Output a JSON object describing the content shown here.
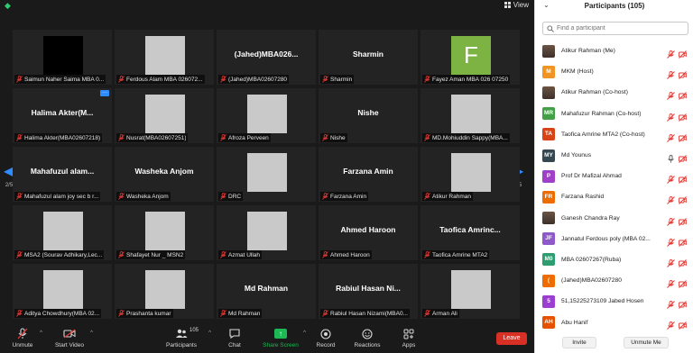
{
  "topbar": {
    "view_label": "View"
  },
  "tiles": [
    {
      "label": "Saimun Naher Saima MBA 0...",
      "display_name": "",
      "media": "black",
      "mic": "muted"
    },
    {
      "label": "Ferdous Alam MBA 026072...",
      "display_name": "",
      "media": "photo",
      "mic": "muted"
    },
    {
      "label": "(Jahed)MBA02607280",
      "display_name": "(Jahed)MBA026...",
      "media": "none",
      "mic": "muted"
    },
    {
      "label": "Sharmin",
      "display_name": "Sharmin",
      "media": "none",
      "mic": "muted"
    },
    {
      "label": "Fayez Aman  MBA 026 07250",
      "display_name": "",
      "media": "letter",
      "letter": "F",
      "mic": "muted"
    },
    {
      "label": "Halima Akter(MBA02607218)",
      "display_name": "Halima  Akter(M...",
      "media": "none",
      "mic": "muted",
      "more": true
    },
    {
      "label": "Nusrat(MBA02607251)",
      "display_name": "",
      "media": "photo",
      "mic": "muted"
    },
    {
      "label": "Afroza Perveen",
      "display_name": "",
      "media": "photo",
      "mic": "muted"
    },
    {
      "label": "Nishe",
      "display_name": "Nishe",
      "media": "none",
      "mic": "muted"
    },
    {
      "label": "MD.Mohiuddin Sappy(MBA...",
      "display_name": "",
      "media": "photo",
      "mic": "muted"
    },
    {
      "label": "Mahafuzul alam joy sec b r...",
      "display_name": "Mahafuzul  alam...",
      "media": "none",
      "mic": "muted"
    },
    {
      "label": "Washeka Anjom",
      "display_name": "Washeka Anjom",
      "media": "none",
      "mic": "muted"
    },
    {
      "label": "DRC",
      "display_name": "",
      "media": "photo",
      "mic": "muted"
    },
    {
      "label": "Farzana Amin",
      "display_name": "Farzana Amin",
      "media": "none",
      "mic": "muted"
    },
    {
      "label": "Atikur Rahman",
      "display_name": "",
      "media": "photo",
      "mic": "muted"
    },
    {
      "label": "MSA2 (Sourav Adhikary,Lec...",
      "display_name": "",
      "media": "photo",
      "mic": "muted"
    },
    {
      "label": "Shafayet Nur _ MSN2",
      "display_name": "",
      "media": "photo",
      "mic": "muted"
    },
    {
      "label": "Azmat Ullah",
      "display_name": "",
      "media": "photo",
      "mic": "muted"
    },
    {
      "label": "Ahmed Haroon",
      "display_name": "Ahmed Haroon",
      "media": "none",
      "mic": "muted"
    },
    {
      "label": "Taofica Amrine MTA2",
      "display_name": "Taofica  Amrinc...",
      "media": "none",
      "mic": "muted"
    },
    {
      "label": "Aditya Chowdhury(MBA 02...",
      "display_name": "",
      "media": "photo",
      "mic": "muted"
    },
    {
      "label": "Prashanta kumar",
      "display_name": "",
      "media": "photo",
      "mic": "muted"
    },
    {
      "label": "Md Rahman",
      "display_name": "Md Rahman",
      "media": "none",
      "mic": "muted"
    },
    {
      "label": "Rabiul Hasan Nizami(MBA0...",
      "display_name": "Rabiul  Hasan  Ni...",
      "media": "none",
      "mic": "muted"
    },
    {
      "label": "Arman Ali",
      "display_name": "",
      "media": "photo",
      "mic": "muted"
    }
  ],
  "pager": {
    "left_page": "2/5",
    "right_page": "2/5"
  },
  "toolbar": {
    "unmute": "Unmute",
    "start_video": "Start Video",
    "participants": "Participants",
    "participants_count": "105",
    "chat": "Chat",
    "share_screen": "Share Screen",
    "record": "Record",
    "reactions": "Reactions",
    "apps": "Apps",
    "leave": "Leave"
  },
  "panel": {
    "title": "Participants (105)",
    "search_placeholder": "Find a participant",
    "invite": "Invite",
    "unmute_me": "Unmute Me",
    "participants": [
      {
        "name": "Atikur Rahman (Me)",
        "initials": "",
        "color": "",
        "image": true,
        "mic": "muted",
        "video": "off"
      },
      {
        "name": "MKM (Host)",
        "initials": "M",
        "color": "#f29423",
        "image": false,
        "mic": "muted",
        "video": "off"
      },
      {
        "name": "Atikur Rahman (Co-host)",
        "initials": "",
        "color": "",
        "image": true,
        "mic": "muted",
        "video": "off"
      },
      {
        "name": "Mahafuzur Rahman (Co-host)",
        "initials": "MR",
        "color": "#43a047",
        "image": false,
        "mic": "muted",
        "video": "off"
      },
      {
        "name": "Taofica Amrine MTA2 (Co-host)",
        "initials": "TA",
        "color": "#d84315",
        "image": false,
        "mic": "muted",
        "video": "off"
      },
      {
        "name": "Md Younus",
        "initials": "MY",
        "color": "#37474f",
        "image": false,
        "mic": "on",
        "video": "off"
      },
      {
        "name": "Prof Dr Mafizal Ahmad",
        "initials": "P",
        "color": "#a040c8",
        "image": false,
        "mic": "muted",
        "video": "off"
      },
      {
        "name": "Farzana Rashid",
        "initials": "FR",
        "color": "#ef6c00",
        "image": false,
        "mic": "muted",
        "video": "off"
      },
      {
        "name": "Ganesh Chandra Ray",
        "initials": "",
        "color": "",
        "image": true,
        "mic": "muted",
        "video": "off"
      },
      {
        "name": "Jannatul Ferdous poly (MBA 02...",
        "initials": "JF",
        "color": "#8e59c8",
        "image": false,
        "mic": "muted",
        "video": "off"
      },
      {
        "name": "MBA 02607267(Ruba)",
        "initials": "M0",
        "color": "#2e9d6f",
        "image": false,
        "mic": "muted",
        "video": "off"
      },
      {
        "name": "(Jahed)MBA02607280",
        "initials": "(",
        "color": "#ef6c00",
        "image": false,
        "mic": "muted",
        "video": "off"
      },
      {
        "name": "51,15225273109 Jabed Hosen",
        "initials": "5",
        "color": "#9c3fd0",
        "image": false,
        "mic": "muted",
        "video": "off"
      },
      {
        "name": "Abu Hanif",
        "initials": "AH",
        "color": "#e65100",
        "image": false,
        "mic": "muted",
        "video": "off"
      }
    ]
  }
}
